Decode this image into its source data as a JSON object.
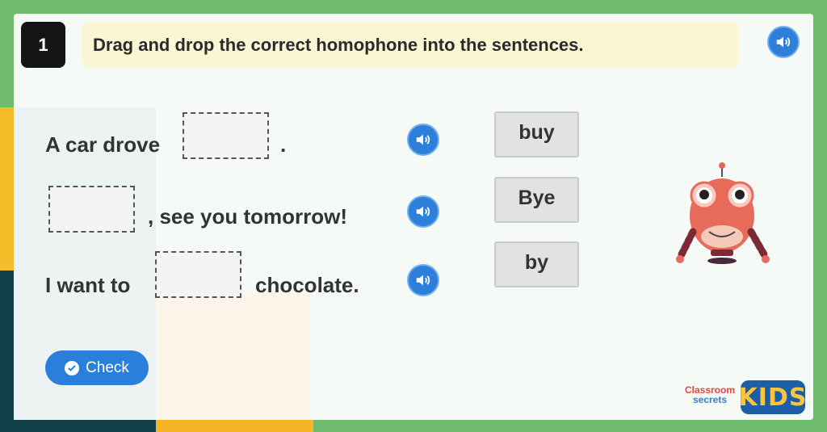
{
  "question": {
    "number": "1",
    "instruction": "Drag and drop the correct homophone into the sentences."
  },
  "sentences": [
    {
      "before": "A car drove",
      "after": "."
    },
    {
      "before": "",
      "after": ", see you tomorrow!"
    },
    {
      "before": "I want to",
      "after": "chocolate."
    }
  ],
  "words": [
    "buy",
    "Bye",
    "by"
  ],
  "check_button": {
    "label": "Check"
  },
  "logo": {
    "line1": "Classroom",
    "line2": "secrets",
    "brand": "KIDS"
  },
  "colors": {
    "accent": "#2a7fdd",
    "frame": "#6dbb6b",
    "instruction_bg": "#fbf6d4"
  },
  "icons": {
    "audio": "speaker-icon",
    "check": "checkmark-circle-icon"
  }
}
